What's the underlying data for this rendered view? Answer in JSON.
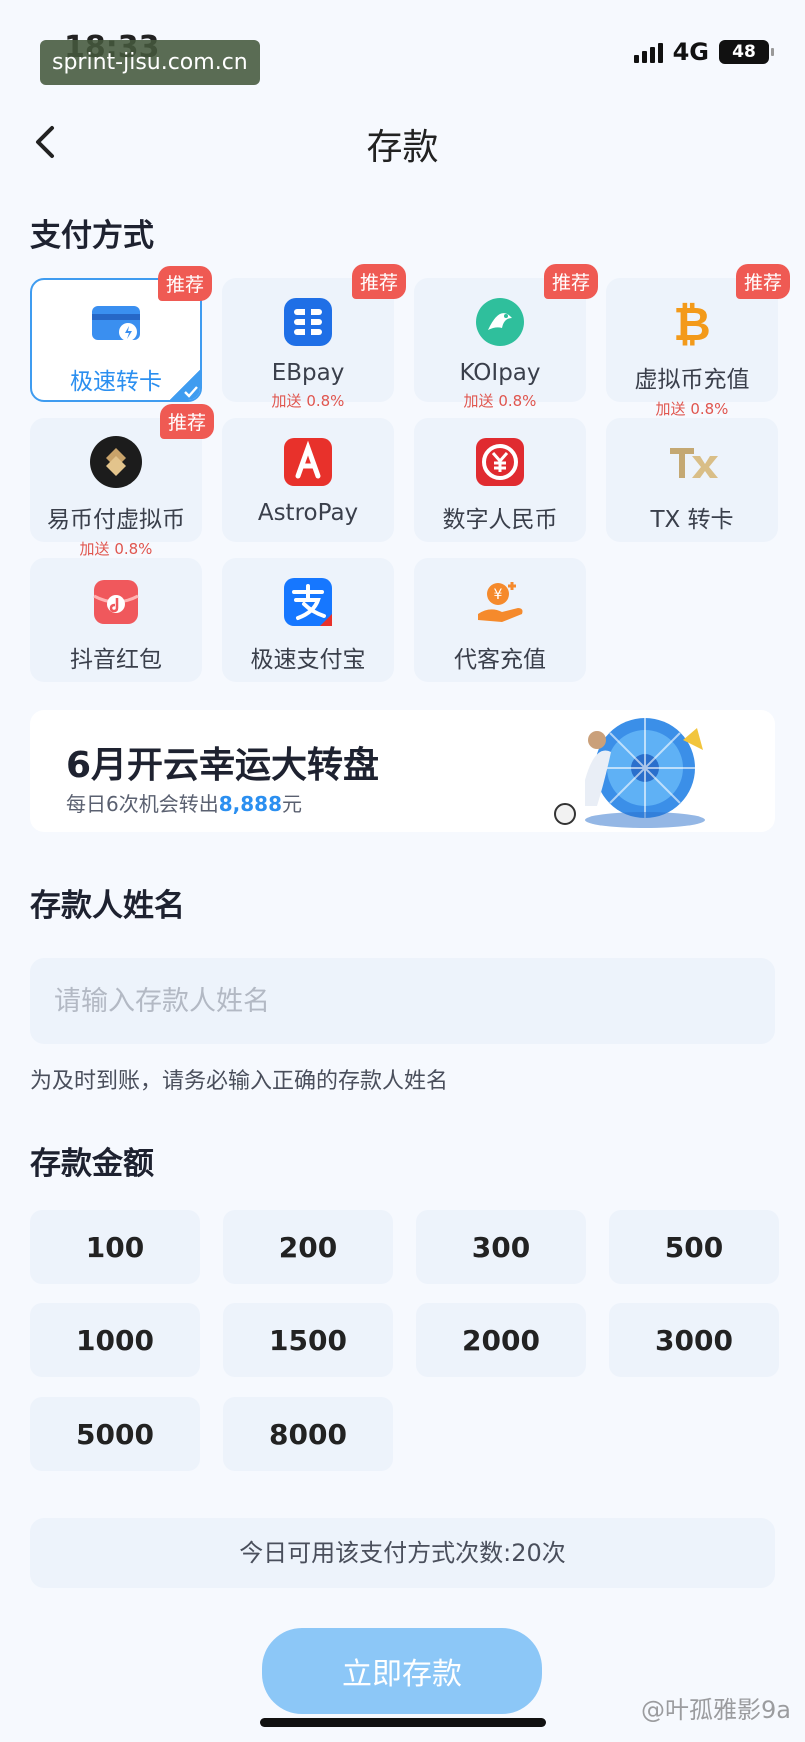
{
  "status_bar": {
    "time": "18:33",
    "network": "4G",
    "battery": "48",
    "watermark": "sprint-jisu.com.cn"
  },
  "header": {
    "title": "存款",
    "back_icon": "chevron-left-icon"
  },
  "payment": {
    "section_title": "支付方式",
    "selected": "极速转卡",
    "methods": [
      {
        "name": "极速转卡",
        "icon": "fast-card-icon",
        "tag": "推荐",
        "bonus": ""
      },
      {
        "name": "EBpay",
        "icon": "ebpay-icon",
        "tag": "推荐",
        "bonus": "加送 0.8%"
      },
      {
        "name": "KOIpay",
        "icon": "koi-fish-icon",
        "tag": "推荐",
        "bonus": "加送 0.8%"
      },
      {
        "name": "虚拟币充值",
        "icon": "bitcoin-icon",
        "tag": "推荐",
        "bonus": "加送 0.8%"
      },
      {
        "name": "易币付虚拟币",
        "icon": "ebifu-icon",
        "tag": "推荐",
        "bonus": "加送 0.8%"
      },
      {
        "name": "AstroPay",
        "icon": "astropay-icon",
        "tag": "",
        "bonus": ""
      },
      {
        "name": "数字人民币",
        "icon": "digital-rmb-icon",
        "tag": "",
        "bonus": ""
      },
      {
        "name": "TX 转卡",
        "icon": "tx-logo-icon",
        "tag": "",
        "bonus": ""
      },
      {
        "name": "抖音红包",
        "icon": "douyin-redpacket-icon",
        "tag": "",
        "bonus": ""
      },
      {
        "name": "极速支付宝",
        "icon": "alipay-icon",
        "tag": "",
        "bonus": ""
      },
      {
        "name": "代客充值",
        "icon": "agent-recharge-icon",
        "tag": "",
        "bonus": ""
      }
    ]
  },
  "banner": {
    "title": "6月开云幸运大转盘",
    "subtitle_prefix": "每日6次机会转出",
    "subtitle_amount": "8,888",
    "subtitle_suffix": "元"
  },
  "depositor": {
    "section_title": "存款人姓名",
    "placeholder": "请输入存款人姓名",
    "value": "",
    "hint": "为及时到账，请务必输入正确的存款人姓名"
  },
  "amount": {
    "section_title": "存款金额",
    "options": [
      "100",
      "200",
      "300",
      "500",
      "1000",
      "1500",
      "2000",
      "3000",
      "5000",
      "8000"
    ]
  },
  "usage_text": "今日可用该支付方式次数:20次",
  "submit_label": "立即存款",
  "footer_watermark": "@叶孤雅影9a",
  "colors": {
    "accent": "#3f9cf0",
    "tag": "#ef5a53",
    "submit": "#8cc7f7",
    "tile": "#edf3fb"
  }
}
